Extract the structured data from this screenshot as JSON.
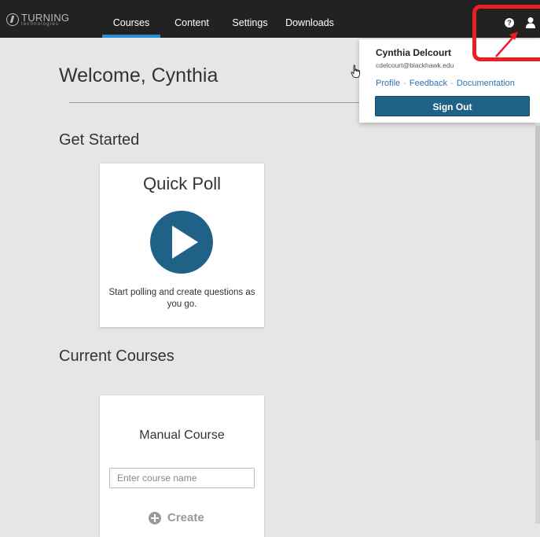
{
  "nav": {
    "logo_main": "TURNING",
    "logo_sub": "technologies",
    "tabs": [
      {
        "label": "Courses",
        "active": true
      },
      {
        "label": "Content",
        "active": false
      },
      {
        "label": "Settings",
        "active": false
      },
      {
        "label": "Downloads",
        "active": false
      }
    ],
    "help_icon": "question-circle-icon",
    "user_icon": "user-icon",
    "accent_color": "#2a8dd4"
  },
  "main": {
    "welcome": "Welcome, Cynthia",
    "get_started_title": "Get Started",
    "quick_poll": {
      "title": "Quick Poll",
      "description": "Start polling and create questions as you go.",
      "icon": "play-circle-icon"
    },
    "current_courses_title": "Current Courses",
    "manual_course": {
      "title": "Manual Course",
      "input_placeholder": "Enter course name",
      "create_label": "Create",
      "create_icon": "plus-circle-icon"
    }
  },
  "user_menu": {
    "name": "Cynthia Delcourt",
    "email": "cdelcourt@blackhawk.edu",
    "links": [
      "Profile",
      "Feedback",
      "Documentation"
    ],
    "separator": "-",
    "sign_out_label": "Sign Out",
    "button_color": "#1f6187"
  },
  "annotation": {
    "highlight_color": "#ee1c24"
  }
}
